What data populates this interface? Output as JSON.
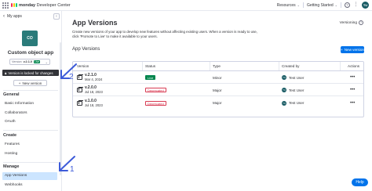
{
  "topbar": {
    "brand": "monday",
    "brand_sub": "Developer Center",
    "resources": "Resources",
    "getting_started": "Getting Started",
    "help_icon": "question-icon",
    "user_initials": "TU",
    "logo_colors": [
      "#f62b54",
      "#ffcc00",
      "#00ca72"
    ]
  },
  "sidebar": {
    "back_label": "My apps",
    "app_logo_text": "CO",
    "app_title": "Custom object app",
    "version_prefix": "Version",
    "version_value": "v.2.1.0",
    "version_status": "Live",
    "lock_notice": "Version is locked for changes",
    "new_version": "New version",
    "sections": [
      {
        "title": "General",
        "items": [
          "Basic Information",
          "Collaborators",
          "OAuth"
        ]
      },
      {
        "title": "Create",
        "items": [
          "Features",
          "Hosting"
        ]
      },
      {
        "title": "Manage",
        "items": [
          "App Versions",
          "Webhooks"
        ]
      }
    ],
    "active_item": "App Versions"
  },
  "main": {
    "title": "App Versions",
    "description": "Create new versions of your app to develop new features without affecting existing users. When a version is ready to use, click 'Promote to Live' to make it available to your users.",
    "versioning_link": "Versioning",
    "section_title": "App Versions",
    "new_version_button": "New version",
    "table": {
      "headers": [
        "Version",
        "Status",
        "Type",
        "Created by",
        "Actions"
      ],
      "rows": [
        {
          "version": "v.2.1.0",
          "date": "Mar 4, 2024",
          "status": "Live",
          "type": "Minor",
          "creator": "Test User",
          "initials": "TU"
        },
        {
          "version": "v.2.0.0",
          "date": "Jul 18, 2023",
          "status": "Deprecated",
          "type": "Major",
          "creator": "Test User",
          "initials": "TU"
        },
        {
          "version": "v.1.0.0",
          "date": "Jul 18, 2023",
          "status": "Deprecated",
          "type": "Major",
          "creator": "Test User",
          "initials": "TU"
        }
      ]
    }
  },
  "help_button": "Help",
  "annotations": [
    "1",
    "2"
  ],
  "colors": {
    "accent": "#0073ea",
    "live": "#00854d",
    "deprecated": "#d83a52",
    "annotation": "#3d5bd9",
    "active_bg": "#cce5ff"
  }
}
